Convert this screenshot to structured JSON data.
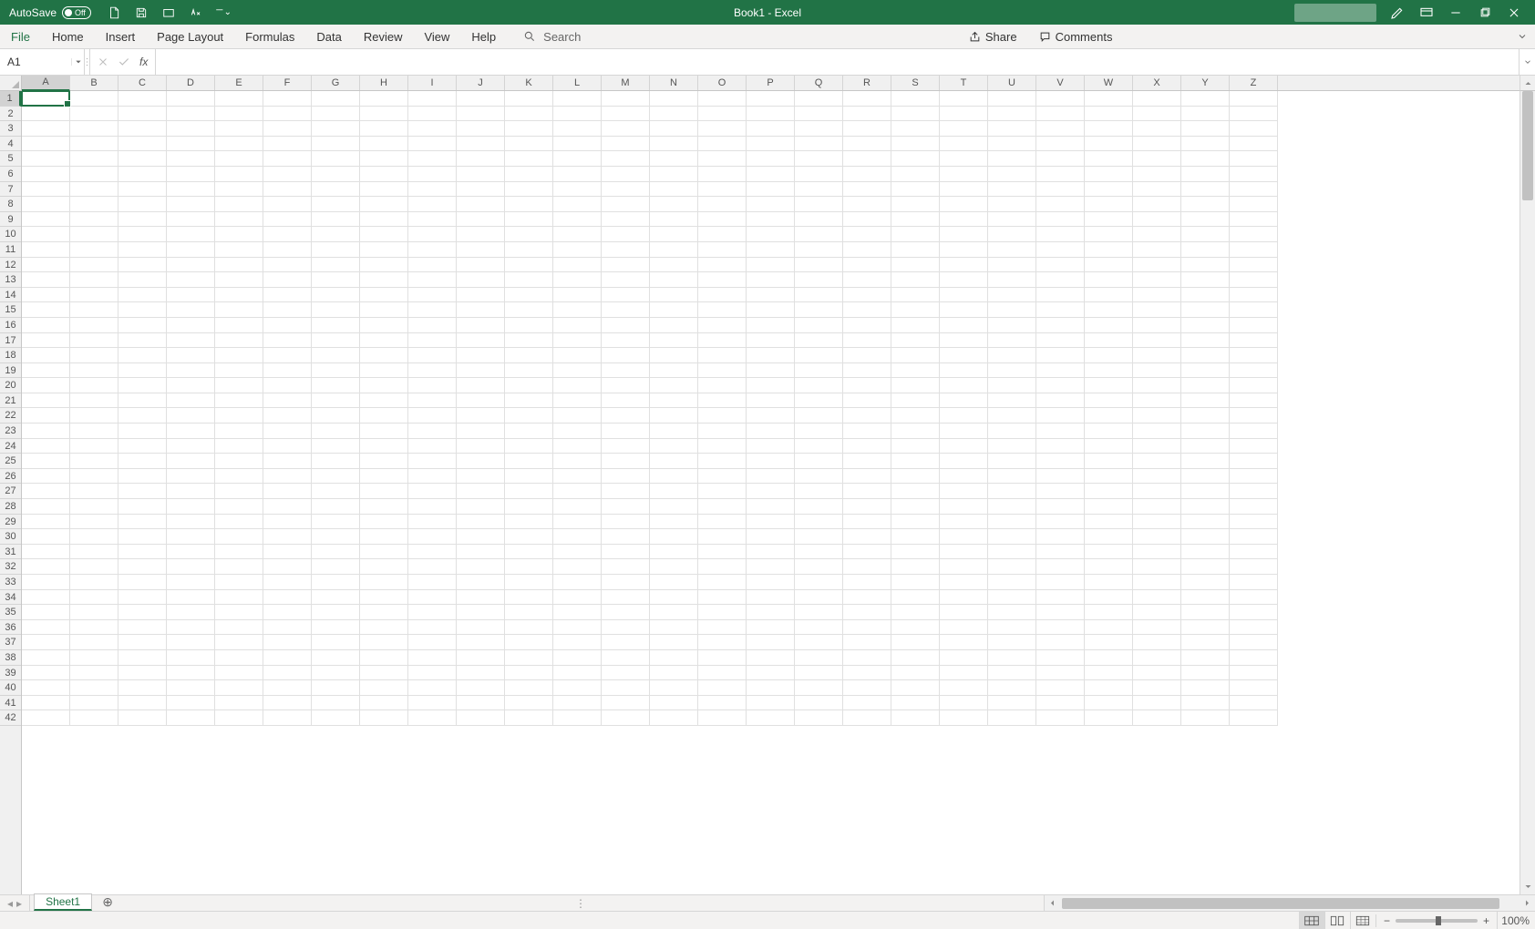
{
  "title_bar": {
    "autosave_label": "AutoSave",
    "autosave_state": "Off",
    "window_title": "Book1  -  Excel"
  },
  "ribbon": {
    "tabs": [
      "File",
      "Home",
      "Insert",
      "Page Layout",
      "Formulas",
      "Data",
      "Review",
      "View",
      "Help"
    ],
    "search_placeholder": "Search",
    "share_label": "Share",
    "comments_label": "Comments"
  },
  "formula_bar": {
    "name_box_value": "A1",
    "fx_label": "fx",
    "formula_value": ""
  },
  "grid": {
    "columns": [
      "A",
      "B",
      "C",
      "D",
      "E",
      "F",
      "G",
      "H",
      "I",
      "J",
      "K",
      "L",
      "M",
      "N",
      "O",
      "P",
      "Q",
      "R",
      "S",
      "T",
      "U",
      "V",
      "W",
      "X",
      "Y",
      "Z"
    ],
    "row_count": 42,
    "active_cell": "A1",
    "active_col_index": 0,
    "active_row_index": 0
  },
  "sheets": {
    "active": "Sheet1",
    "tabs": [
      "Sheet1"
    ]
  },
  "status": {
    "zoom_pct": "100%"
  }
}
